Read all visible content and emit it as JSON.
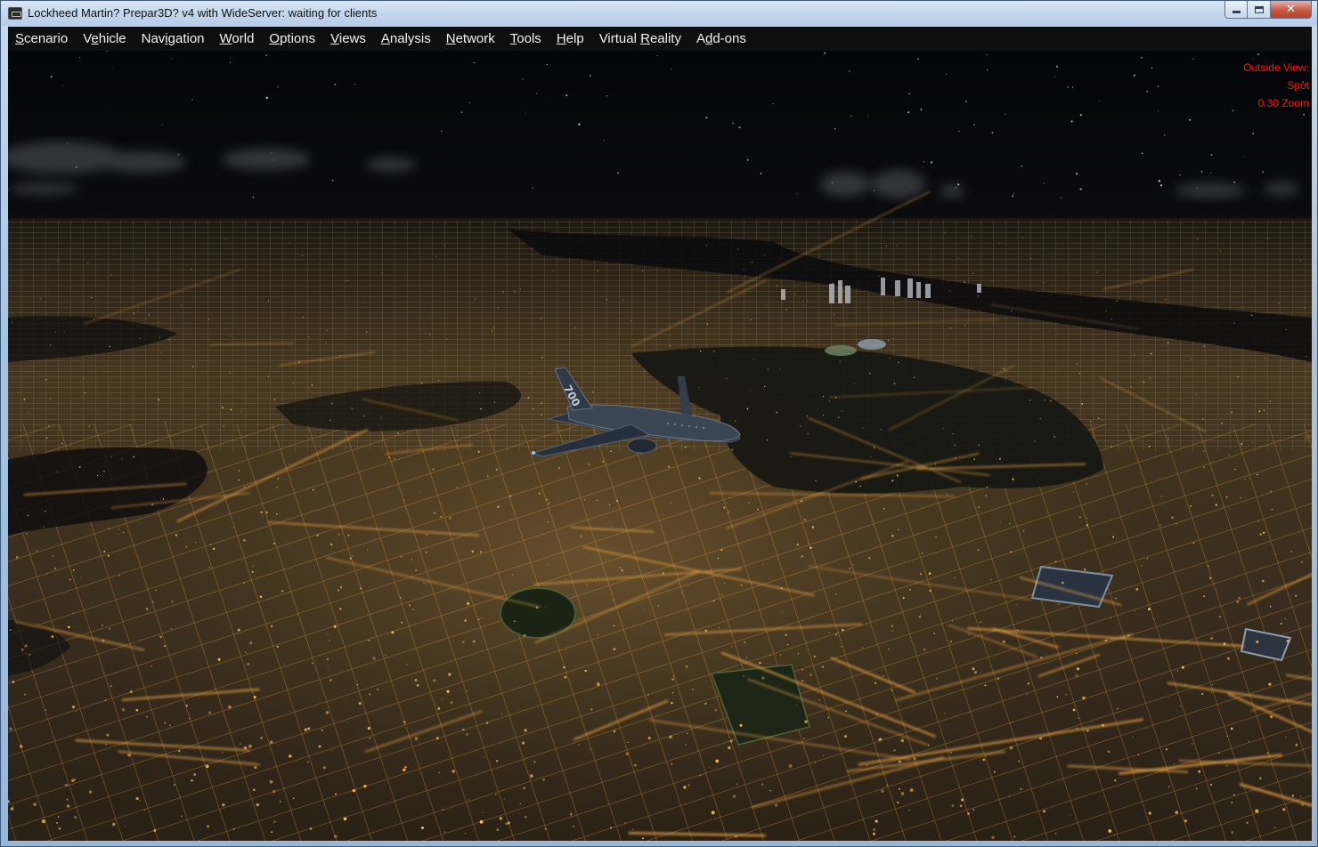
{
  "window": {
    "title": "Lockheed Martin? Prepar3D? v4 with WideServer: waiting for clients",
    "close_glyph": "✕"
  },
  "menu": {
    "items": [
      {
        "label": "Scenario",
        "mnemonic": "S"
      },
      {
        "label": "Vehicle",
        "mnemonic": "e"
      },
      {
        "label": "Navigation",
        "mnemonic": "i"
      },
      {
        "label": "World",
        "mnemonic": "W"
      },
      {
        "label": "Options",
        "mnemonic": "O"
      },
      {
        "label": "Views",
        "mnemonic": "V"
      },
      {
        "label": "Analysis",
        "mnemonic": "A"
      },
      {
        "label": "Network",
        "mnemonic": "N"
      },
      {
        "label": "Tools",
        "mnemonic": "T"
      },
      {
        "label": "Help",
        "mnemonic": "H"
      },
      {
        "label": "Virtual Reality",
        "mnemonic": "R"
      },
      {
        "label": "Add-ons",
        "mnemonic": "d"
      }
    ]
  },
  "hud": {
    "view_mode": "Outside View:",
    "view_name": "Spot",
    "zoom": "0.30 Zoom",
    "text_color": "#ff1414"
  },
  "viewport": {
    "scene": "night city aerial view with airliner",
    "aircraft_tail_text": "700"
  },
  "colors": {
    "menubar_bg": "#0f0f0f",
    "menu_text": "#f2f2f2",
    "titlebar_bg": "#c3d7ed",
    "close_button": "#c75a44",
    "city_lights": "#f0a340",
    "night_sky": "#050609"
  }
}
